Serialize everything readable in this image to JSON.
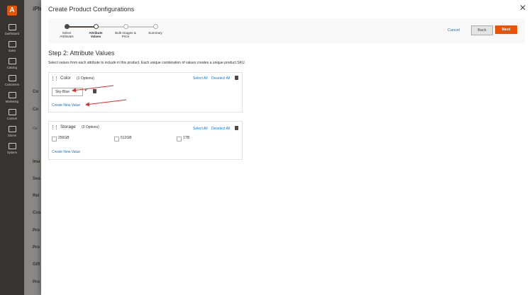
{
  "sidebar": {
    "logo": "A",
    "items": [
      {
        "label": "Dashboard",
        "icon": "dashboard-icon"
      },
      {
        "label": "Sales",
        "icon": "dollar-icon"
      },
      {
        "label": "Catalog",
        "icon": "cube-icon"
      },
      {
        "label": "Customers",
        "icon": "people-icon"
      },
      {
        "label": "Marketing",
        "icon": "megaphone-icon"
      },
      {
        "label": "Content",
        "icon": "layout-icon"
      },
      {
        "label": "Stores",
        "icon": "store-icon"
      },
      {
        "label": "System",
        "icon": "gear-icon"
      }
    ]
  },
  "background_page": {
    "labels": [
      "iPh",
      "Co",
      "Co",
      "Co",
      "Ima",
      "Sea",
      "Rel",
      "Cus",
      "Pro",
      "Pro",
      "Gift",
      "Pro"
    ]
  },
  "modal": {
    "title": "Create Product Configurations",
    "close_label": "✕",
    "wizard": {
      "steps": [
        {
          "line1": "Select",
          "line2": "Attributes",
          "state": "done"
        },
        {
          "line1": "Attribute",
          "line2": "Values",
          "state": "active"
        },
        {
          "line1": "Bulk Images &",
          "line2": "Price",
          "state": "todo"
        },
        {
          "line1": "Summary",
          "line2": "",
          "state": "todo"
        }
      ],
      "cancel_label": "Cancel",
      "back_label": "Back",
      "next_label": "Next"
    },
    "step_title": "Step 2: Attribute Values",
    "step_desc": "Select values from each attribute to include in this product. Each unique combination of values creates a unique product SKU.",
    "attributes": [
      {
        "name": "Color",
        "count": "(1 Options)",
        "select_all": "Select All",
        "deselect_all": "Deselect All",
        "new_value": "Sky-Blue",
        "create_new": "Create New Value"
      },
      {
        "name": "Storage",
        "count": "(3 Options)",
        "select_all": "Select All",
        "deselect_all": "Deselect All",
        "options": [
          "256GB",
          "512GB",
          "1TB"
        ],
        "create_new": "Create New Value"
      }
    ]
  },
  "colors": {
    "accent": "#eb5202",
    "link": "#007bdb",
    "sidebar_bg": "#373330",
    "annotation_arrow": "#e02b27"
  }
}
